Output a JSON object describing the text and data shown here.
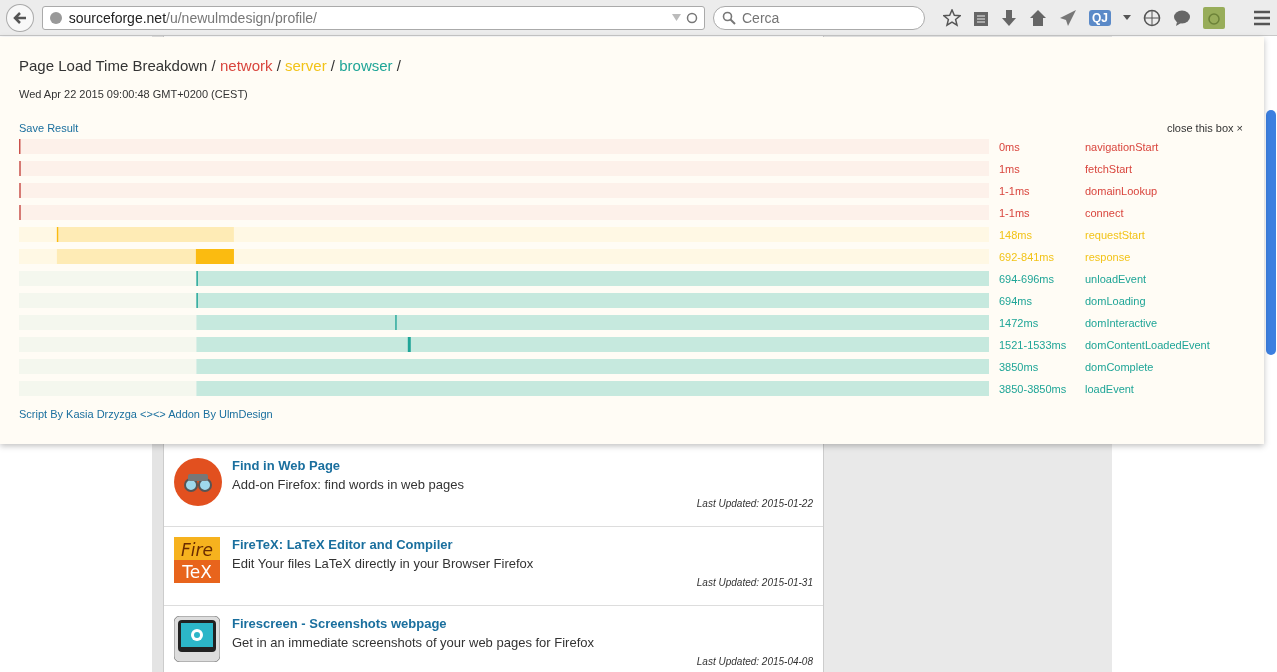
{
  "browser": {
    "url_host": "sourceforge.net",
    "url_path": "/u/newulmdesign/profile/",
    "search": {
      "placeholder": "Cerca"
    },
    "extension_badge": "QJ"
  },
  "panel": {
    "title": [
      {
        "text": "Page Load Time Breakdown",
        "kind": "plain"
      },
      {
        "text": "network",
        "kind": "network"
      },
      {
        "text": "server",
        "kind": "server"
      },
      {
        "text": "browser",
        "kind": "browser"
      }
    ],
    "separator": "/",
    "date": "Wed Apr 22 2015 09:00:48 GMT+0200 (CEST)",
    "save_link": "Save Result",
    "close_link": "close this box ×",
    "rows": [
      {
        "reading": "0ms",
        "event": "navigationStart",
        "kind": "network"
      },
      {
        "reading": "1ms",
        "event": "fetchStart",
        "kind": "network"
      },
      {
        "reading": "1-1ms",
        "event": "domainLookup",
        "kind": "network"
      },
      {
        "reading": "1-1ms",
        "event": "connect",
        "kind": "network"
      },
      {
        "reading": "148ms",
        "event": "requestStart",
        "kind": "server"
      },
      {
        "reading": "692-841ms",
        "event": "response",
        "kind": "server"
      },
      {
        "reading": "694-696ms",
        "event": "unloadEvent",
        "kind": "browser"
      },
      {
        "reading": "694ms",
        "event": "domLoading",
        "kind": "browser"
      },
      {
        "reading": "1472ms",
        "event": "domInteractive",
        "kind": "browser"
      },
      {
        "reading": "1521-1533ms",
        "event": "domContentLoadedEvent",
        "kind": "browser"
      },
      {
        "reading": "3850ms",
        "event": "domComplete",
        "kind": "browser"
      },
      {
        "reading": "3850-3850ms",
        "event": "loadEvent",
        "kind": "browser"
      }
    ],
    "credits": "Script By Kasia Drzyzga <><> Addon By UlmDesign"
  },
  "projects": [
    {
      "title": "Find in Web Page",
      "description": "Add-on Firefox: find words in web pages",
      "updated": "Last Updated: 2015-01-22",
      "kind": "binoculars"
    },
    {
      "title": "FireTeX: LaTeX Editor and Compiler",
      "description": "Edit Your files LaTeX directly in your Browser Firefox",
      "updated": "Last Updated: 2015-01-31",
      "kind": "logo",
      "logo_lines": [
        "Fire",
        "TeX"
      ]
    },
    {
      "title": "Firescreen - Screenshots webpage",
      "description": "Get in an immediate screenshots of your web pages for Firefox",
      "updated": "Last Updated: 2015-04-08",
      "kind": "camera"
    }
  ]
}
